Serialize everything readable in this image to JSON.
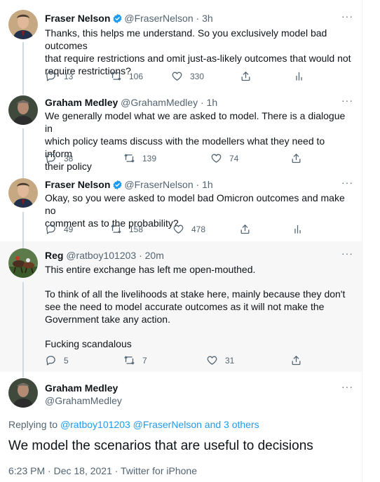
{
  "tweets": [
    {
      "name": "Fraser Nelson",
      "handle": "@FraserNelson",
      "time": "3h",
      "sep": "·",
      "verified": true,
      "lines": [
        "Thanks, this helps me understand. So you exclusively model bad outcomes",
        "that require restrictions and omit just-as-likely outcomes that would not",
        "require restrictions?"
      ],
      "replies": "13",
      "retweets": "106",
      "likes": "330"
    },
    {
      "name": "Graham Medley",
      "handle": "@GrahamMedley",
      "time": "1h",
      "sep": "·",
      "verified": false,
      "lines": [
        "We generally model what we are asked to model. There is a dialogue in",
        "which policy teams discuss with the modellers what they need to inform",
        "their policy"
      ],
      "replies": "38",
      "retweets": "139",
      "likes": "74"
    },
    {
      "name": "Fraser Nelson",
      "handle": "@FraserNelson",
      "time": "1h",
      "sep": "·",
      "verified": true,
      "lines": [
        "Okay, so you were asked to model bad Omicron outcomes and make no",
        "comment as to the probability?"
      ],
      "replies": "49",
      "retweets": "158",
      "likes": "478"
    },
    {
      "name": "Reg",
      "handle": "@ratboy101203",
      "time": "20m",
      "sep": "·",
      "verified": false,
      "paragraphs": [
        "This entire exchange has left me open-mouthed.",
        "To think of all the livelihoods at stake here, mainly because they don't see the need to model accurate outcomes as it will not make the Government take any action.",
        "Fucking scandalous"
      ],
      "replies": "5",
      "retweets": "7",
      "likes": "31"
    }
  ],
  "main_tweet": {
    "name": "Graham Medley",
    "handle": "@GrahamMedley",
    "replying_prefix": "Replying to",
    "replying_users": "@ratboy101203 @FraserNelson and 3 others",
    "text": "We model the scenarios that are useful to decisions",
    "timestamp": "6:23 PM · Dec 18, 2021 · Twitter for iPhone"
  },
  "icons": {
    "more": "more-horizontal-icon",
    "reply": "reply-bubble-icon",
    "retweet": "retweet-icon",
    "like": "heart-icon",
    "share": "share-icon",
    "analytics": "analytics-bars-icon",
    "verified": "verified-badge-icon"
  },
  "colors": {
    "link": "#1d9bf0",
    "muted": "#536471",
    "highlight_bg": "#f7f7f7",
    "verified": "#1d9bf0"
  }
}
